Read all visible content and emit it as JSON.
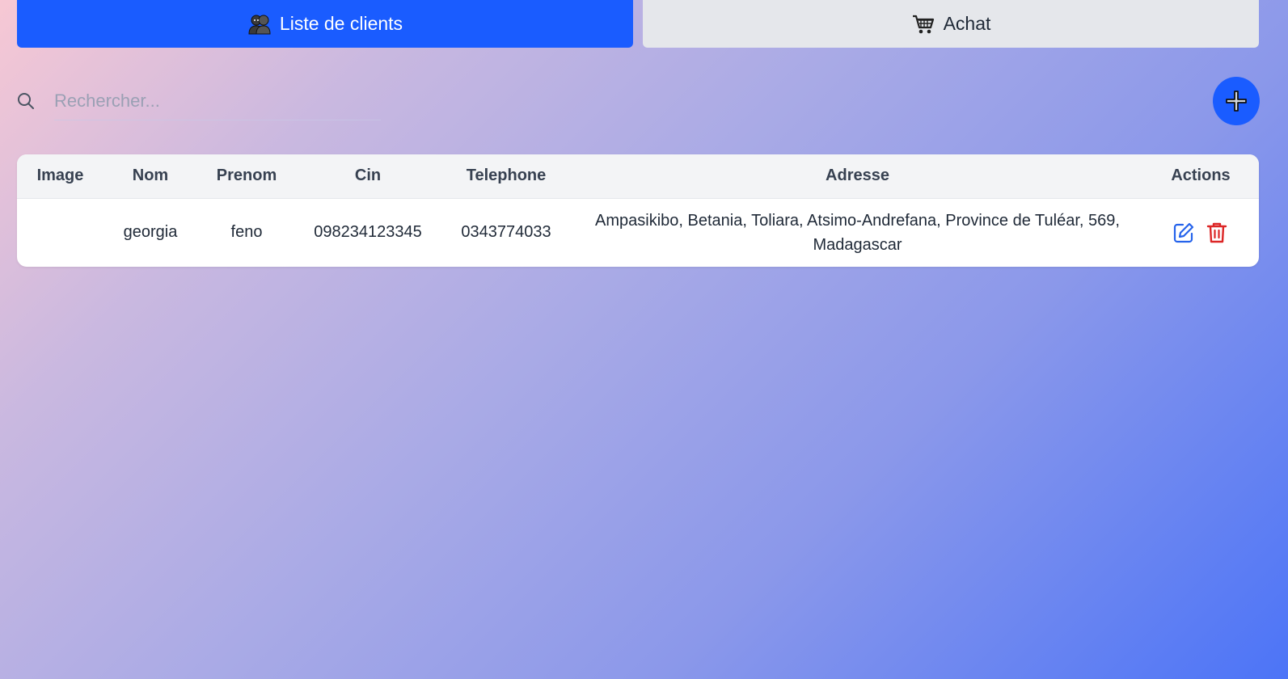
{
  "tabs": [
    {
      "label": "Liste de clients",
      "icon": "users-icon",
      "active": true
    },
    {
      "label": "Achat",
      "icon": "shopping-cart-icon",
      "active": false
    }
  ],
  "search": {
    "placeholder": "Rechercher...",
    "value": ""
  },
  "add_button": {
    "icon": "plus-icon"
  },
  "table": {
    "headers": [
      "Image",
      "Nom",
      "Prenom",
      "Cin",
      "Telephone",
      "Adresse",
      "Actions"
    ],
    "rows": [
      {
        "image": "",
        "nom": "georgia",
        "prenom": "feno",
        "cin": "098234123345",
        "telephone": "0343774033",
        "adresse": "Ampasikibo, Betania, Toliara, Atsimo-Andrefana, Province de Tuléar, 569, Madagascar",
        "actions": [
          "edit-icon",
          "trash-icon"
        ]
      }
    ]
  },
  "colors": {
    "accent": "#1a5cff",
    "inactive_tab": "#e5e7eb",
    "edit": "#2563eb",
    "delete": "#dc2626"
  }
}
